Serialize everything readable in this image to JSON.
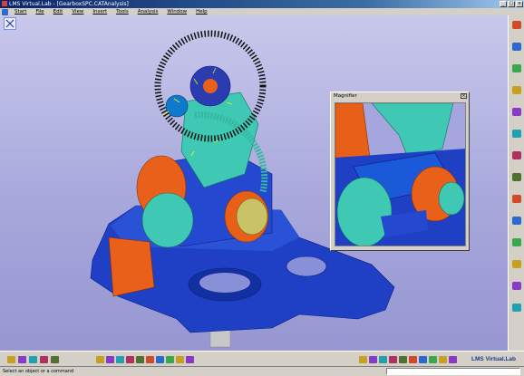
{
  "window": {
    "title": "LMS Virtual.Lab - [GearboxSPC.CATAnalysis]",
    "controls": [
      "minimize",
      "maximize",
      "close"
    ]
  },
  "menubar": {
    "items": [
      "Start",
      "File",
      "Edit",
      "View",
      "Insert",
      "Tools",
      "Analysis",
      "Window",
      "Help"
    ]
  },
  "magnifier": {
    "title": "Magnifier",
    "close_label": "×"
  },
  "status": {
    "prompt": "Select an object or a command",
    "command_input": ""
  },
  "branding": {
    "logo": "LMS Virtual.Lab"
  },
  "colors": {
    "background_top": "#c8c8ec",
    "background_bottom": "#9696d2",
    "housing_blue": "#1f3fc4",
    "flange_orange": "#e8601a",
    "bracket_teal": "#3fc8b4",
    "gear_teal": "#36b8a0",
    "encoder_black": "#111111"
  },
  "icons": {
    "compass": "compass-icon",
    "right_toolbar": [
      "select-icon",
      "sketch-icon",
      "material-icon",
      "mesh-icon",
      "load-icon",
      "restraint-icon",
      "solve-icon",
      "image-icon",
      "animate-icon",
      "sensor-icon",
      "report-icon",
      "group-icon",
      "measure-icon",
      "analysis-icon"
    ],
    "bottom_toolbar_left": [
      "fly-icon",
      "look-icon",
      "zoom-area-icon",
      "render-icon",
      "hide-icon"
    ],
    "bottom_toolbar_mid": [
      "new-icon",
      "open-icon",
      "save-icon",
      "print-icon",
      "cut-icon",
      "copy-icon",
      "paste-icon",
      "undo-icon",
      "redo-icon",
      "whatsthis-icon"
    ],
    "bottom_toolbar_right": [
      "fit-all-icon",
      "pan-icon",
      "rotate-icon",
      "zoom-in-icon",
      "zoom-out-icon",
      "normal-view-icon",
      "iso-view-icon",
      "shading-icon",
      "hide-show-icon",
      "swap-icon"
    ]
  }
}
